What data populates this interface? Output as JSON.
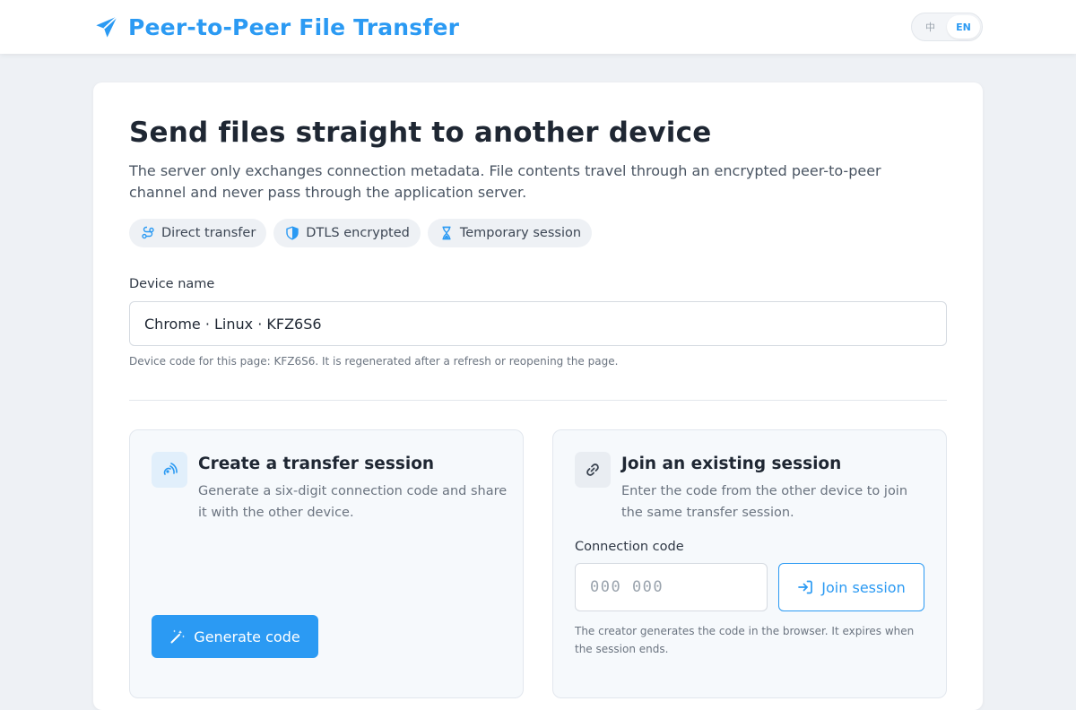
{
  "header": {
    "title": "Peer-to-Peer File Transfer",
    "brand_icon": "paper-plane-icon",
    "languages": [
      {
        "label": "中",
        "active": false
      },
      {
        "label": "EN",
        "active": true
      }
    ]
  },
  "main": {
    "headline": "Send files straight to another device",
    "intro": "The server only exchanges connection metadata. File contents travel through an encrypted peer-to-peer channel and never pass through the application server.",
    "chips": [
      {
        "label": "Direct transfer",
        "icon": "route-icon"
      },
      {
        "label": "DTLS encrypted",
        "icon": "shield-icon"
      },
      {
        "label": "Temporary session",
        "icon": "hourglass-icon"
      }
    ],
    "device": {
      "label": "Device name",
      "value": "Chrome · Linux · KFZ6S6",
      "hint": "Device code for this page: KFZ6S6. It is regenerated after a refresh or reopening the page."
    }
  },
  "create": {
    "icon": "broadcast-icon",
    "title": "Create a transfer session",
    "description": "Generate a six-digit connection code and share it with the other device.",
    "button_label": "Generate code",
    "button_icon": "magic-wand-icon"
  },
  "join": {
    "icon": "link-icon",
    "title": "Join an existing session",
    "description": "Enter the code from the other device to join the same transfer session.",
    "code_label": "Connection code",
    "code_placeholder": "000 000",
    "code_value": "",
    "button_label": "Join session",
    "button_icon": "sign-in-icon",
    "hint": "The creator generates the code in the browser. It expires when the session ends."
  },
  "colors": {
    "accent": "#2b9af3",
    "page_background": "#eef1f5",
    "card_background": "#ffffff",
    "panel_background": "#f6f9fc"
  }
}
